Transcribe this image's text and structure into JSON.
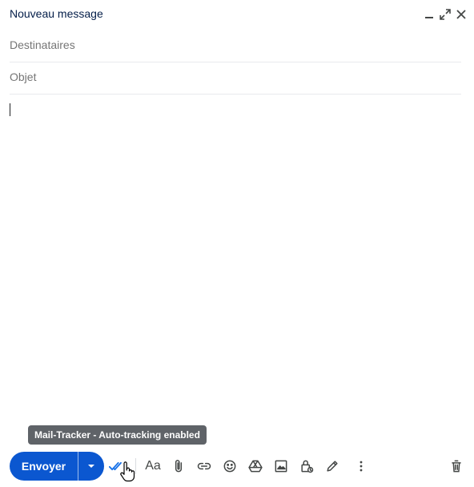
{
  "header": {
    "title": "Nouveau message",
    "minimize_icon": "minimize-icon",
    "expand_icon": "expand-icon",
    "close_icon": "close-icon"
  },
  "fields": {
    "recipients_placeholder": "Destinataires",
    "subject_placeholder": "Objet"
  },
  "tooltip": {
    "text": "Mail-Tracker - Auto-tracking enabled"
  },
  "toolbar": {
    "send_label": "Envoyer",
    "format_label": "Aa",
    "icons": [
      "send-options-icon",
      "mail-tracker-icon",
      "format-text-icon",
      "attach-icon",
      "link-icon",
      "emoji-icon",
      "drive-icon",
      "photo-icon",
      "confidential-lock-icon",
      "signature-pen-icon",
      "more-options-icon",
      "trash-icon"
    ]
  },
  "colors": {
    "accent": "#0b57d0",
    "title": "#041e49",
    "tracker": "#1a73e8",
    "tooltip_bg": "#5f6368"
  }
}
